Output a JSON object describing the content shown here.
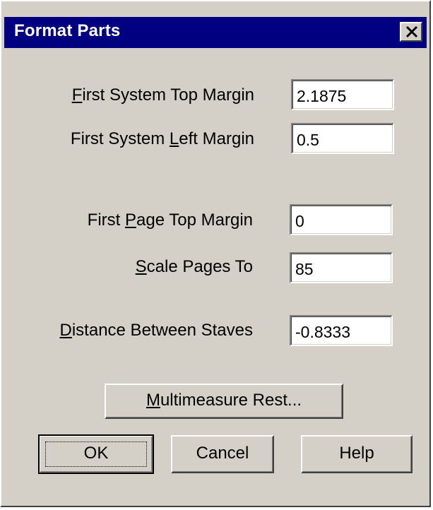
{
  "window": {
    "title": "Format Parts",
    "close_icon": "close-x-icon"
  },
  "fields": {
    "first_system_top_margin": {
      "label_pre": "",
      "label_key": "F",
      "label_post": "irst System Top Margin",
      "value": "2.1875"
    },
    "first_system_left_margin": {
      "label_pre": "First System ",
      "label_key": "L",
      "label_post": "eft Margin",
      "value": "0.5"
    },
    "first_page_top_margin": {
      "label_pre": "First ",
      "label_key": "P",
      "label_post": "age Top Margin",
      "value": "0"
    },
    "scale_pages_to": {
      "label_pre": "",
      "label_key": "S",
      "label_post": "cale Pages To",
      "value": "85"
    },
    "distance_between_staves": {
      "label_pre": "",
      "label_key": "D",
      "label_post": "istance Between Staves",
      "value": "-0.8333"
    }
  },
  "buttons": {
    "multimeasure": {
      "pre": "",
      "key": "M",
      "post": "ultimeasure Rest..."
    },
    "ok": "OK",
    "cancel": "Cancel",
    "help": "Help"
  },
  "colors": {
    "titlebar": "#000080",
    "face": "#d4d0c8"
  }
}
